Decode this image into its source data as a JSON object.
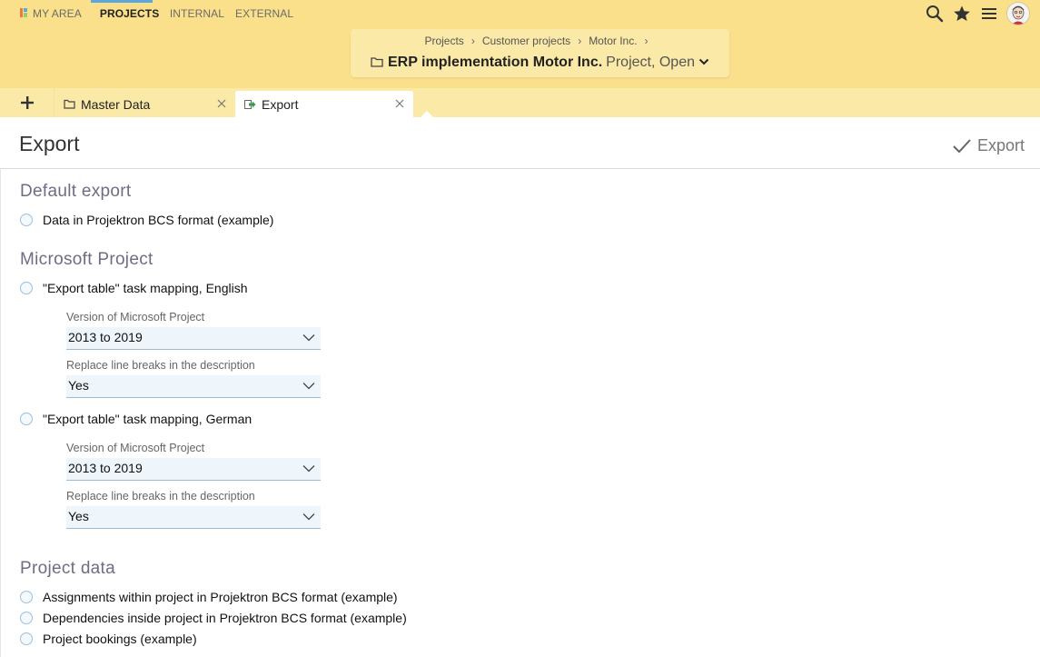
{
  "topnav": {
    "items": [
      {
        "label": "MY AREA"
      },
      {
        "label": "PROJECTS"
      },
      {
        "label": "INTERNAL"
      },
      {
        "label": "EXTERNAL"
      }
    ],
    "icons": [
      "search-icon",
      "star-icon",
      "menu-icon",
      "avatar"
    ]
  },
  "context": {
    "breadcrumb": [
      "Projects",
      "Customer projects",
      "Motor Inc."
    ],
    "breadcrumb_separator": "›",
    "title": "ERP implementation Motor Inc.",
    "meta": "Project, Open"
  },
  "tabs": [
    {
      "label": "Master Data",
      "icon": "folder-icon"
    },
    {
      "label": "Export",
      "icon": "export-icon"
    }
  ],
  "page": {
    "title": "Export",
    "action_label": "Export"
  },
  "sections": {
    "default": {
      "title": "Default export",
      "options": [
        "Data in Projektron BCS format (example)"
      ]
    },
    "msproject": {
      "title": "Microsoft Project",
      "option_en": "\"Export table\" task mapping, English",
      "option_de": "\"Export table\" task mapping, German",
      "version_label": "Version of Microsoft Project",
      "version_value": "2013 to 2019",
      "linebreak_label": "Replace line breaks in the description",
      "linebreak_value": "Yes"
    },
    "project": {
      "title": "Project data",
      "options": [
        "Assignments within project in Projektron BCS format (example)",
        "Dependencies inside project in Projektron BCS format (example)",
        "Project bookings (example)"
      ]
    }
  },
  "colors": {
    "topbar": "#fae08a",
    "tabstrip": "#fbe9a7",
    "active_tab_indicator": "#5aa7de",
    "section_title": "#6d6d84"
  }
}
